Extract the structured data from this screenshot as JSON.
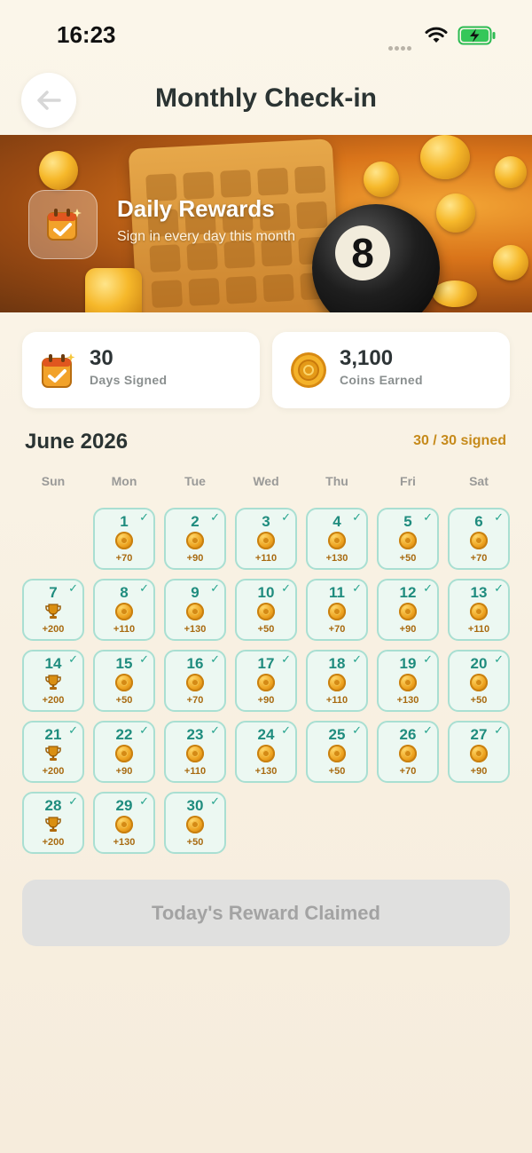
{
  "status_bar": {
    "time": "16:23"
  },
  "header": {
    "title": "Monthly Check-in",
    "back_icon": "arrow-left-icon"
  },
  "banner": {
    "title": "Daily Rewards",
    "subtitle": "Sign in every day this month",
    "ball_number": "8",
    "icon": "calendar-check-icon"
  },
  "stats": [
    {
      "value": "30",
      "label": "Days Signed",
      "icon": "calendar-check-icon"
    },
    {
      "value": "3,100",
      "label": "Coins Earned",
      "icon": "coin-icon"
    }
  ],
  "calendar": {
    "month": "June 2026",
    "progress": "30 / 30 signed",
    "weekdays": [
      "Sun",
      "Mon",
      "Tue",
      "Wed",
      "Thu",
      "Fri",
      "Sat"
    ],
    "first_weekday_index": 1,
    "days": [
      {
        "day": "1",
        "reward": "+70",
        "icon": "coin-icon",
        "signed": true
      },
      {
        "day": "2",
        "reward": "+90",
        "icon": "coin-icon",
        "signed": true
      },
      {
        "day": "3",
        "reward": "+110",
        "icon": "coin-icon",
        "signed": true
      },
      {
        "day": "4",
        "reward": "+130",
        "icon": "coin-icon",
        "signed": true
      },
      {
        "day": "5",
        "reward": "+50",
        "icon": "coin-icon",
        "signed": true
      },
      {
        "day": "6",
        "reward": "+70",
        "icon": "coin-icon",
        "signed": true
      },
      {
        "day": "7",
        "reward": "+200",
        "icon": "trophy-icon",
        "signed": true
      },
      {
        "day": "8",
        "reward": "+110",
        "icon": "coin-icon",
        "signed": true
      },
      {
        "day": "9",
        "reward": "+130",
        "icon": "coin-icon",
        "signed": true
      },
      {
        "day": "10",
        "reward": "+50",
        "icon": "coin-icon",
        "signed": true
      },
      {
        "day": "11",
        "reward": "+70",
        "icon": "coin-icon",
        "signed": true
      },
      {
        "day": "12",
        "reward": "+90",
        "icon": "coin-icon",
        "signed": true
      },
      {
        "day": "13",
        "reward": "+110",
        "icon": "coin-icon",
        "signed": true
      },
      {
        "day": "14",
        "reward": "+200",
        "icon": "trophy-icon",
        "signed": true
      },
      {
        "day": "15",
        "reward": "+50",
        "icon": "coin-icon",
        "signed": true
      },
      {
        "day": "16",
        "reward": "+70",
        "icon": "coin-icon",
        "signed": true
      },
      {
        "day": "17",
        "reward": "+90",
        "icon": "coin-icon",
        "signed": true
      },
      {
        "day": "18",
        "reward": "+110",
        "icon": "coin-icon",
        "signed": true
      },
      {
        "day": "19",
        "reward": "+130",
        "icon": "coin-icon",
        "signed": true
      },
      {
        "day": "20",
        "reward": "+50",
        "icon": "coin-icon",
        "signed": true
      },
      {
        "day": "21",
        "reward": "+200",
        "icon": "trophy-icon",
        "signed": true
      },
      {
        "day": "22",
        "reward": "+90",
        "icon": "coin-icon",
        "signed": true
      },
      {
        "day": "23",
        "reward": "+110",
        "icon": "coin-icon",
        "signed": true
      },
      {
        "day": "24",
        "reward": "+130",
        "icon": "coin-icon",
        "signed": true
      },
      {
        "day": "25",
        "reward": "+50",
        "icon": "coin-icon",
        "signed": true
      },
      {
        "day": "26",
        "reward": "+70",
        "icon": "coin-icon",
        "signed": true
      },
      {
        "day": "27",
        "reward": "+90",
        "icon": "coin-icon",
        "signed": true
      },
      {
        "day": "28",
        "reward": "+200",
        "icon": "trophy-icon",
        "signed": true
      },
      {
        "day": "29",
        "reward": "+130",
        "icon": "coin-icon",
        "signed": true
      },
      {
        "day": "30",
        "reward": "+50",
        "icon": "coin-icon",
        "signed": true
      }
    ]
  },
  "claim_button": {
    "label": "Today's Reward Claimed",
    "enabled": false
  },
  "colors": {
    "accent": "#1f8c7e",
    "gold": "#c68a1b",
    "cell_bg": "#ecf8f2",
    "cell_border": "#a9dfd2",
    "page_bg": "#f8f0e2"
  }
}
